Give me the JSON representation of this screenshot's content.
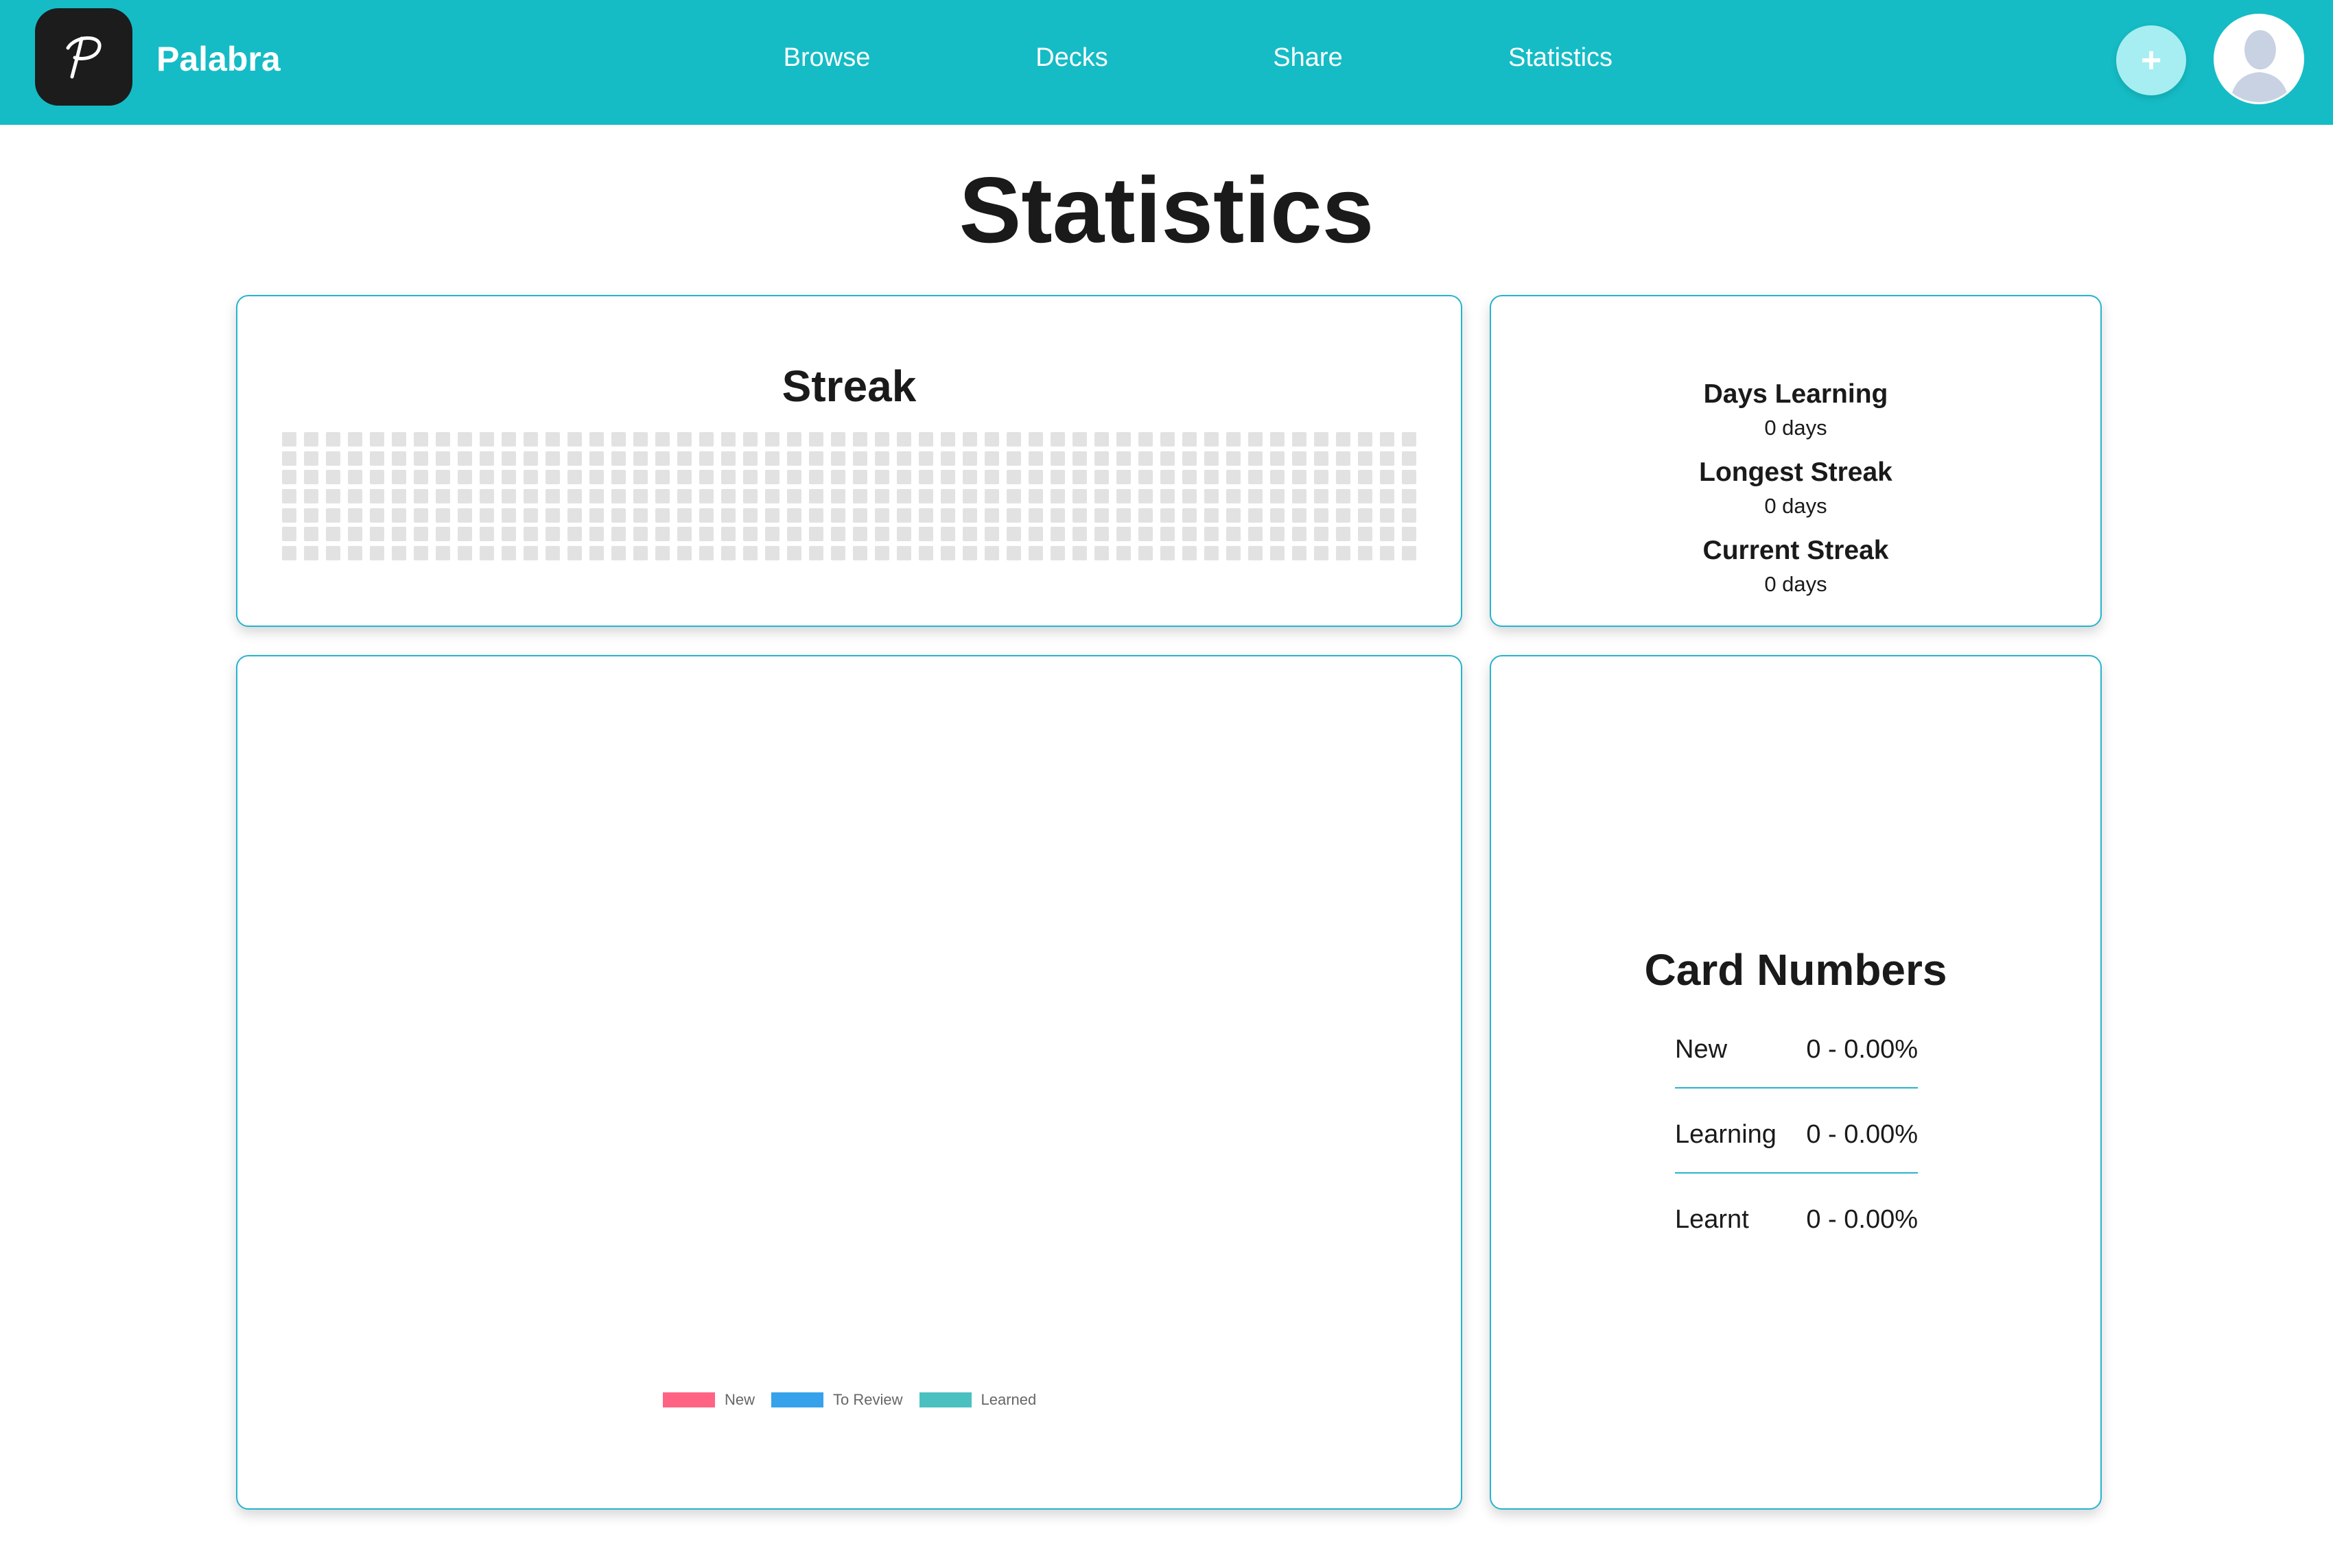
{
  "app": {
    "name": "Palabra",
    "logo_letter": "P"
  },
  "nav": {
    "items": [
      {
        "label": "Browse"
      },
      {
        "label": "Decks"
      },
      {
        "label": "Share"
      },
      {
        "label": "Statistics"
      }
    ],
    "add_button_label": "+",
    "avatar_icon": "user-avatar-icon"
  },
  "page": {
    "title": "Statistics"
  },
  "streak": {
    "title": "Streak",
    "weeks": 52,
    "days_per_week": 7,
    "activity_level": 0
  },
  "summary": {
    "days_learning": {
      "label": "Days Learning",
      "value": "0 days"
    },
    "longest_streak": {
      "label": "Longest Streak",
      "value": "0 days"
    },
    "current_streak": {
      "label": "Current Streak",
      "value": "0 days"
    }
  },
  "chart_data": {
    "type": "bar",
    "categories": [],
    "series": [
      {
        "name": "New",
        "values": [],
        "color": "#ff6384"
      },
      {
        "name": "To Review",
        "values": [],
        "color": "#36a2eb"
      },
      {
        "name": "Learned",
        "values": [],
        "color": "#4bc0c0"
      }
    ],
    "title": "",
    "xlabel": "",
    "ylabel": "",
    "legend": "bottom"
  },
  "card_numbers": {
    "title": "Card Numbers",
    "rows": [
      {
        "label": "New",
        "value": "0 - 0.00%"
      },
      {
        "label": "Learning",
        "value": "0 - 0.00%"
      },
      {
        "label": "Learnt",
        "value": "0 - 0.00%"
      }
    ]
  },
  "colors": {
    "header": "#15bcc5",
    "card_border": "#25b4ce",
    "streak_cell_empty": "#e2e2e2"
  }
}
